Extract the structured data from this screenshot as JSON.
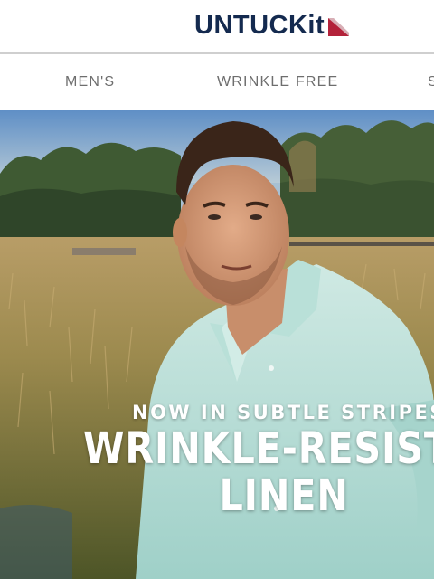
{
  "brand": {
    "logo_text": "UNTUCKit",
    "logo_color": "#142a4f",
    "accent_color": "#b3223a"
  },
  "nav": {
    "items": [
      {
        "label": "MEN'S"
      },
      {
        "label": "WRINKLE FREE"
      },
      {
        "label": "S"
      }
    ]
  },
  "hero": {
    "eyebrow": "NOW IN SUBTLE STRIPES",
    "headline_line1": "WRINKLE-RESISTANT",
    "headline_line2": "LINEN",
    "image_icon": "hero-photo"
  }
}
